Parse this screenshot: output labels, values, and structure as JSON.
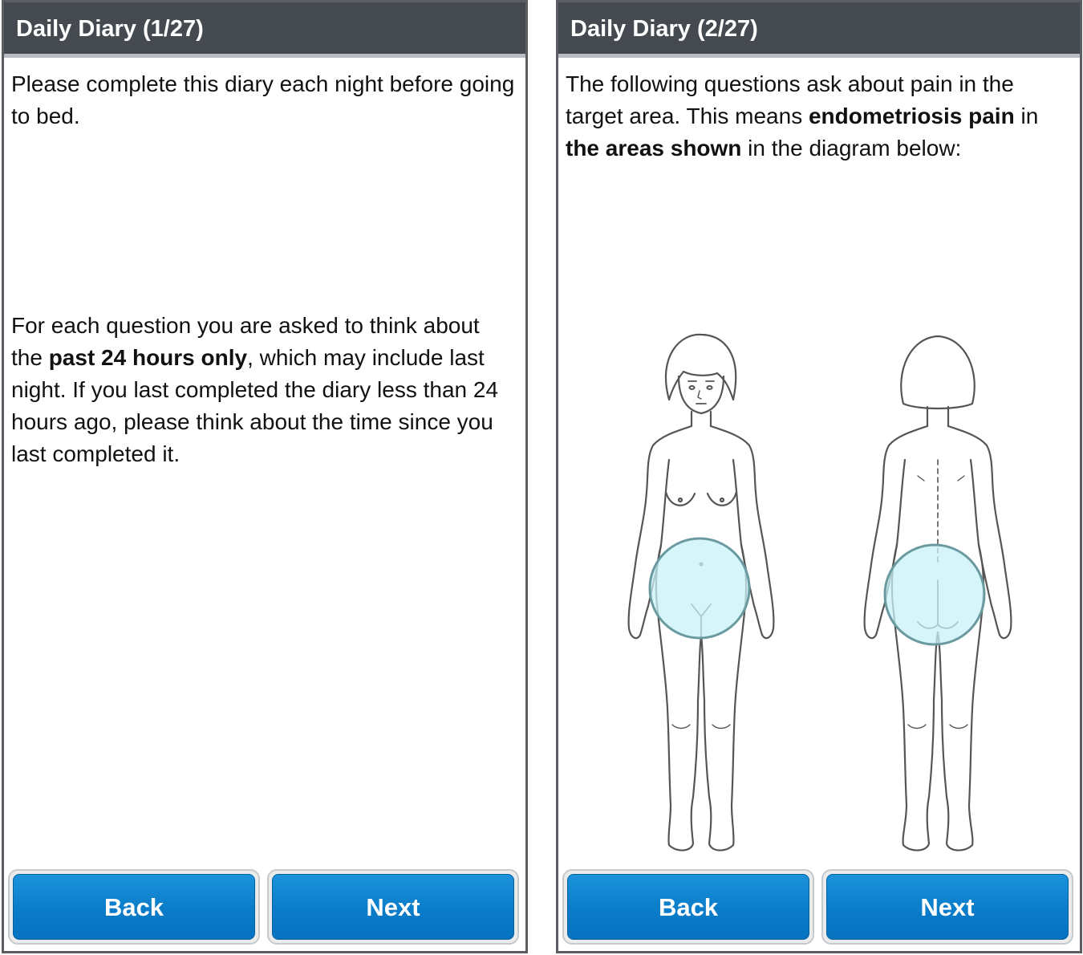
{
  "screens": [
    {
      "title": "Daily Diary (1/27)",
      "paragraph1": "Please complete this diary each night before going to bed.",
      "paragraph2_part1": "For each question you are asked to think about the ",
      "paragraph2_bold": "past 24 hours only",
      "paragraph2_part2": ", which may include last night. If you last completed the diary less than 24 hours ago, please think about the time since you last completed it.",
      "back_label": "Back",
      "next_label": "Next"
    },
    {
      "title": "Daily Diary (2/27)",
      "paragraph1_part1": "The following questions ask about pain in the target area. This means ",
      "paragraph1_bold1": "endometriosis pain",
      "paragraph1_part2": " in ",
      "paragraph1_bold2": "the areas shown",
      "paragraph1_part3": " in the diagram below:",
      "back_label": "Back",
      "next_label": "Next"
    }
  ],
  "colors": {
    "title_bar": "#454a50",
    "button_blue": "#0a7cc9",
    "highlight_circle": "#c8f2fa",
    "circle_outline": "#6a9aa0"
  },
  "icons": {
    "front_figure": "body-front-figure",
    "back_figure": "body-back-figure"
  }
}
